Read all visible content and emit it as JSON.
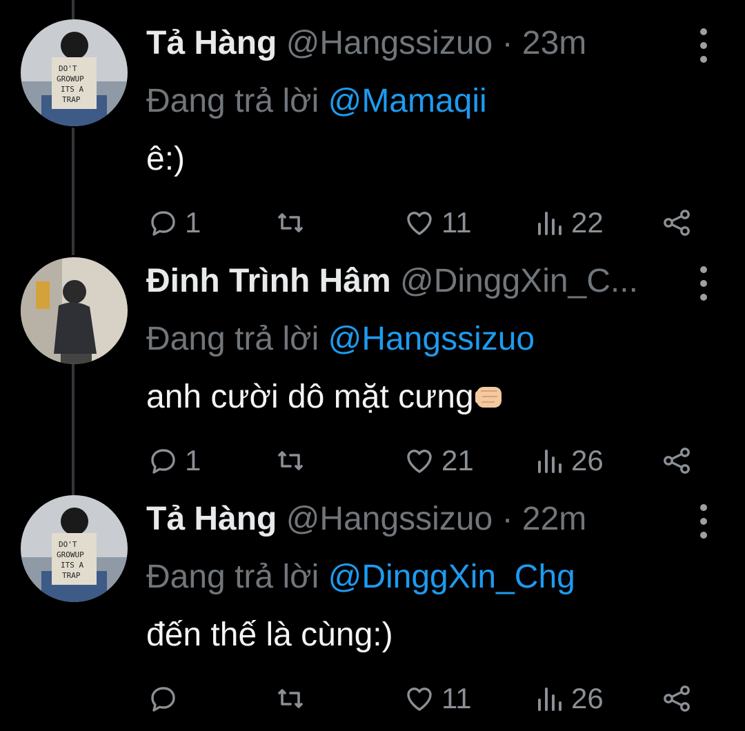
{
  "tweets": [
    {
      "name": "Tả Hàng",
      "handle": "@Hangssizuo",
      "time": "23m",
      "reply_prefix": "Đang trả lời",
      "reply_to": "@Mamaqii",
      "text": "ê:)",
      "replies": "1",
      "retweets": "",
      "likes": "11",
      "views": "22",
      "avatar": "avatar-hangssizuo"
    },
    {
      "name": "Đinh Trình Hâm",
      "handle": "@DinggXin_C...",
      "time": "",
      "reply_prefix": "Đang trả lời",
      "reply_to": "@Hangssizuo",
      "text": "anh cười dô mặt cưng",
      "text_emoji": "fist-emoji",
      "replies": "1",
      "retweets": "",
      "likes": "21",
      "views": "26",
      "avatar": "avatar-dinggxin"
    },
    {
      "name": "Tả Hàng",
      "handle": "@Hangssizuo",
      "time": "22m",
      "reply_prefix": "Đang trả lời",
      "reply_to": "@DinggXin_Chg",
      "text": "đến thế là cùng:)",
      "replies": "",
      "retweets": "",
      "likes": "11",
      "views": "26",
      "avatar": "avatar-hangssizuo"
    }
  ],
  "separator": "·",
  "colors": {
    "background": "#000000",
    "mention": "#1d9bf0",
    "muted": "#71767b",
    "thread_line": "#333639"
  },
  "icons": [
    "reply-icon",
    "retweet-icon",
    "like-icon",
    "views-icon",
    "share-icon",
    "more-icon"
  ]
}
